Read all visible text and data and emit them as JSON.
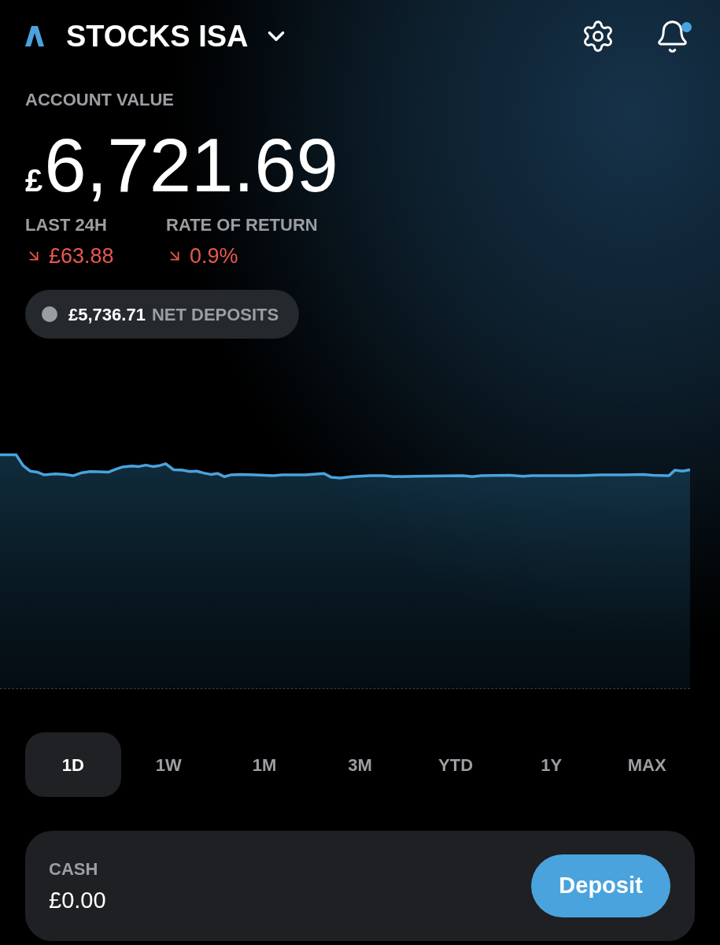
{
  "header": {
    "title": "STOCKS ISA",
    "unread": true
  },
  "account_value": {
    "label": "ACCOUNT VALUE",
    "currency": "£",
    "amount": "6,721.69"
  },
  "stats": [
    {
      "label": "LAST 24H",
      "value": "£63.88",
      "falling": true
    },
    {
      "label": "RATE OF RETURN",
      "value": "0.9%",
      "falling": true
    }
  ],
  "net_deposits": {
    "amount": "£5,736.71",
    "label": "NET DEPOSITS"
  },
  "ranges": [
    {
      "label": "1D",
      "selected": true
    },
    {
      "label": "1W",
      "selected": false
    },
    {
      "label": "1M",
      "selected": false
    },
    {
      "label": "3M",
      "selected": false
    },
    {
      "label": "YTD",
      "selected": false
    },
    {
      "label": "1Y",
      "selected": false
    },
    {
      "label": "MAX",
      "selected": false
    }
  ],
  "cash": {
    "label": "CASH",
    "amount": "£0.00",
    "button": "Deposit"
  }
}
